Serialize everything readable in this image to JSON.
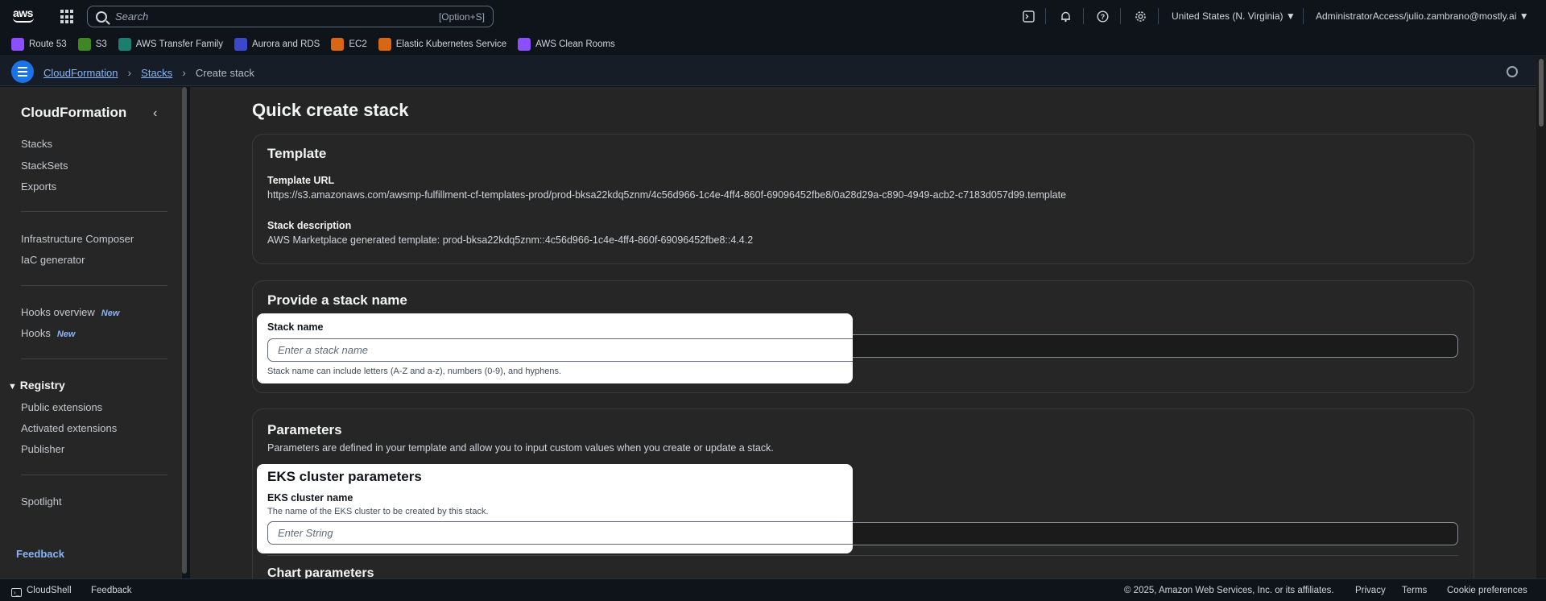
{
  "topnav": {
    "search_placeholder": "Search",
    "search_shortcut": "[Option+S]",
    "region": "United States (N. Virginia)",
    "account": "AdministratorAccess/julio.zambrano@mostly.ai",
    "icons": [
      "cloudshell-icon",
      "bell-icon",
      "help-icon",
      "gear-icon"
    ]
  },
  "favorites": [
    {
      "label": "Route 53",
      "color": "#8c4fff"
    },
    {
      "label": "S3",
      "color": "#3f8624"
    },
    {
      "label": "AWS Transfer Family",
      "color": "#1b7f6e"
    },
    {
      "label": "Aurora and RDS",
      "color": "#3b48cc"
    },
    {
      "label": "EC2",
      "color": "#d86613"
    },
    {
      "label": "Elastic Kubernetes Service",
      "color": "#d86613"
    },
    {
      "label": "AWS Clean Rooms",
      "color": "#8c4fff"
    }
  ],
  "breadcrumb": {
    "items": [
      "CloudFormation",
      "Stacks"
    ],
    "current": "Create stack"
  },
  "sidebar": {
    "title": "CloudFormation",
    "group1": [
      "Stacks",
      "StackSets",
      "Exports"
    ],
    "group2": [
      "Infrastructure Composer",
      "IaC generator"
    ],
    "group3": [
      {
        "label": "Hooks overview",
        "badge": "New"
      },
      {
        "label": "Hooks",
        "badge": "New"
      }
    ],
    "registry": {
      "label": "Registry",
      "items": [
        "Public extensions",
        "Activated extensions",
        "Publisher"
      ]
    },
    "spotlight": "Spotlight",
    "feedback": "Feedback"
  },
  "main": {
    "title": "Quick create stack",
    "template": {
      "heading": "Template",
      "url_label": "Template URL",
      "url_value": "https://s3.amazonaws.com/awsmp-fulfillment-cf-templates-prod/prod-bksa22kdq5znm/4c56d966-1c4e-4ff4-860f-69096452fbe8/0a28d29a-c890-4949-acb2-c7183d057d99.template",
      "desc_label": "Stack description",
      "desc_value": "AWS Marketplace generated template: prod-bksa22kdq5znm::4c56d966-1c4e-4ff4-860f-69096452fbe8::4.4.2"
    },
    "stack_name": {
      "heading": "Provide a stack name",
      "label": "Stack name",
      "placeholder": "Enter a stack name",
      "hint": "Stack name can include letters (A-Z and a-z), numbers (0-9), and hyphens."
    },
    "parameters": {
      "heading": "Parameters",
      "description": "Parameters are defined in your template and allow you to input custom values when you create or update a stack.",
      "eks_heading": "EKS cluster parameters",
      "eks_label": "EKS cluster name",
      "eks_hint": "The name of the EKS cluster to be created by this stack.",
      "eks_placeholder": "Enter String",
      "chart_heading": "Chart parameters"
    }
  },
  "footer": {
    "cloudshell": "CloudShell",
    "feedback": "Feedback",
    "copyright": "© 2025, Amazon Web Services, Inc. or its affiliates.",
    "privacy": "Privacy",
    "terms": "Terms",
    "cookies": "Cookie preferences"
  }
}
